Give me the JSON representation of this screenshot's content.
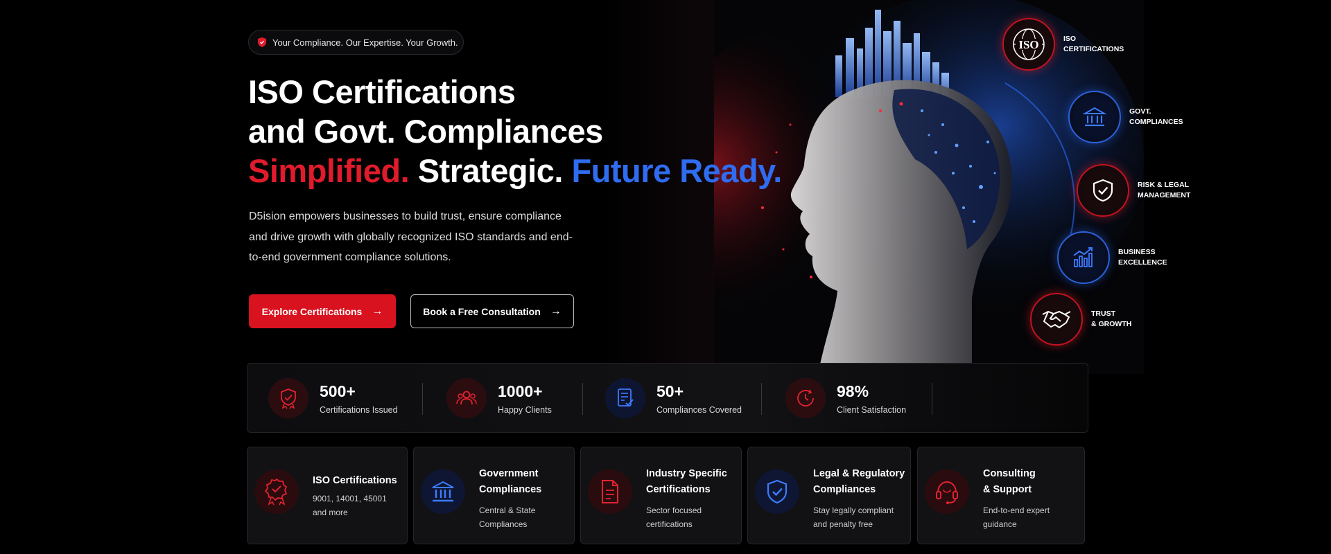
{
  "hero": {
    "pill_text": "Your Compliance. Our Expertise. Your Growth.",
    "title_line1": "ISO Certifications",
    "title_line2": "and Govt. Compliances",
    "tagline_red": "Simplified.",
    "tagline_white": "Strategic.",
    "tagline_blue": "Future Ready.",
    "description": "D5ision empowers businesses to build trust, ensure compliance and drive growth with globally recognized ISO standards and end-to-end government compliance solutions.",
    "primary_button": "Explore Certifications",
    "secondary_button": "Book a Free Consultation"
  },
  "badges": [
    {
      "icon": "iso-globe-icon",
      "label_line1": "ISO",
      "label_line2": "CERTIFICATIONS",
      "color": "red",
      "iso_text": "ISO"
    },
    {
      "icon": "government-building-icon",
      "label_line1": "GOVT.",
      "label_line2": "COMPLIANCES",
      "color": "blue"
    },
    {
      "icon": "shield-check-icon",
      "label_line1": "RISK & LEGAL",
      "label_line2": "MANAGEMENT",
      "color": "red"
    },
    {
      "icon": "bar-chart-growth-icon",
      "label_line1": "BUSINESS",
      "label_line2": "EXCELLENCE",
      "color": "blue"
    },
    {
      "icon": "handshake-icon",
      "label_line1": "TRUST",
      "label_line2": "& GROWTH",
      "color": "red"
    }
  ],
  "stats": [
    {
      "icon": "certificate-shield-icon",
      "value": "500+",
      "label": "Certifications Issued",
      "color": "red"
    },
    {
      "icon": "users-group-icon",
      "value": "1000+",
      "label": "Happy Clients",
      "color": "red"
    },
    {
      "icon": "document-check-icon",
      "value": "50+",
      "label": "Compliances Covered",
      "color": "blue"
    },
    {
      "icon": "clock-icon",
      "value": "98%",
      "label": "Client Satisfaction",
      "color": "red"
    }
  ],
  "cards": [
    {
      "icon": "award-ribbon-icon",
      "title_line1": "ISO Certifications",
      "title_line2": "",
      "sub_line1": "9001, 14001, 45001",
      "sub_line2": "and more",
      "color": "red"
    },
    {
      "icon": "government-building-icon",
      "title_line1": "Government",
      "title_line2": "Compliances",
      "sub_line1": "Central & State",
      "sub_line2": "Compliances",
      "color": "blue"
    },
    {
      "icon": "document-icon",
      "title_line1": "Industry Specific",
      "title_line2": "Certifications",
      "sub_line1": "Sector focused",
      "sub_line2": "certifications",
      "color": "red"
    },
    {
      "icon": "shield-check-icon",
      "title_line1": "Legal & Regulatory",
      "title_line2": "Compliances",
      "sub_line1": "Stay legally compliant",
      "sub_line2": "and penalty free",
      "color": "blue"
    },
    {
      "icon": "headset-icon",
      "title_line1": "Consulting",
      "title_line2": "& Support",
      "sub_line1": "End-to-end expert",
      "sub_line2": "guidance",
      "color": "red"
    }
  ],
  "colors": {
    "accent_red": "#d8121f",
    "accent_blue": "#2f6cf0",
    "background": "#000000"
  }
}
